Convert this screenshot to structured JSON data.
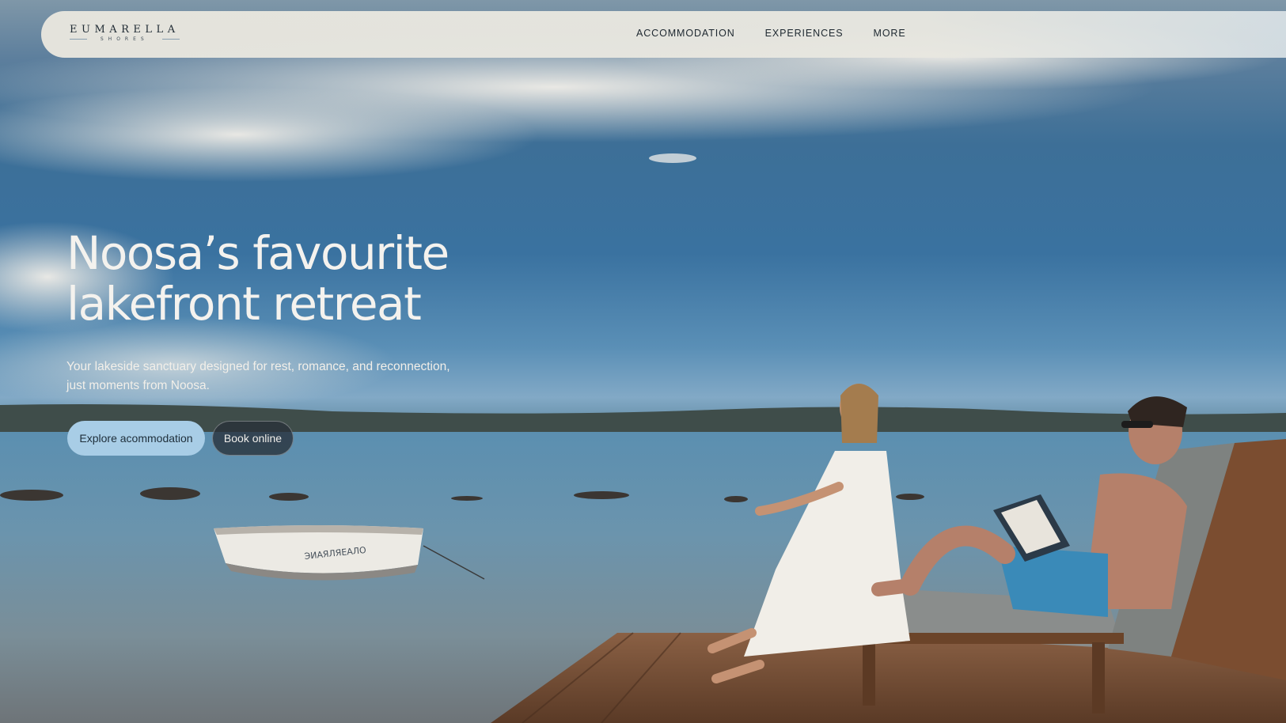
{
  "header": {
    "logo_main": "EUMARELLA",
    "logo_sub": "SHORES",
    "nav": [
      {
        "label": "ACCOMMODATION"
      },
      {
        "label": "EXPERIENCES"
      },
      {
        "label": "MORE"
      }
    ]
  },
  "hero": {
    "headline_line1": "Noosa’s favourite",
    "headline_line2": "lakefront retreat",
    "subtitle_line1": "Your lakeside sanctuary designed for rest, romance, and reconnection,",
    "subtitle_line2": "just moments from Noosa.",
    "primary_button": "Explore acommodation",
    "secondary_button": "Book online",
    "boat_name": "ЭИАЯЛЯЕАЛО"
  },
  "colors": {
    "primary_button_bg": "#a8cde6",
    "secondary_button_bg": "#2f383f",
    "nav_bg": "#e8e6de"
  }
}
